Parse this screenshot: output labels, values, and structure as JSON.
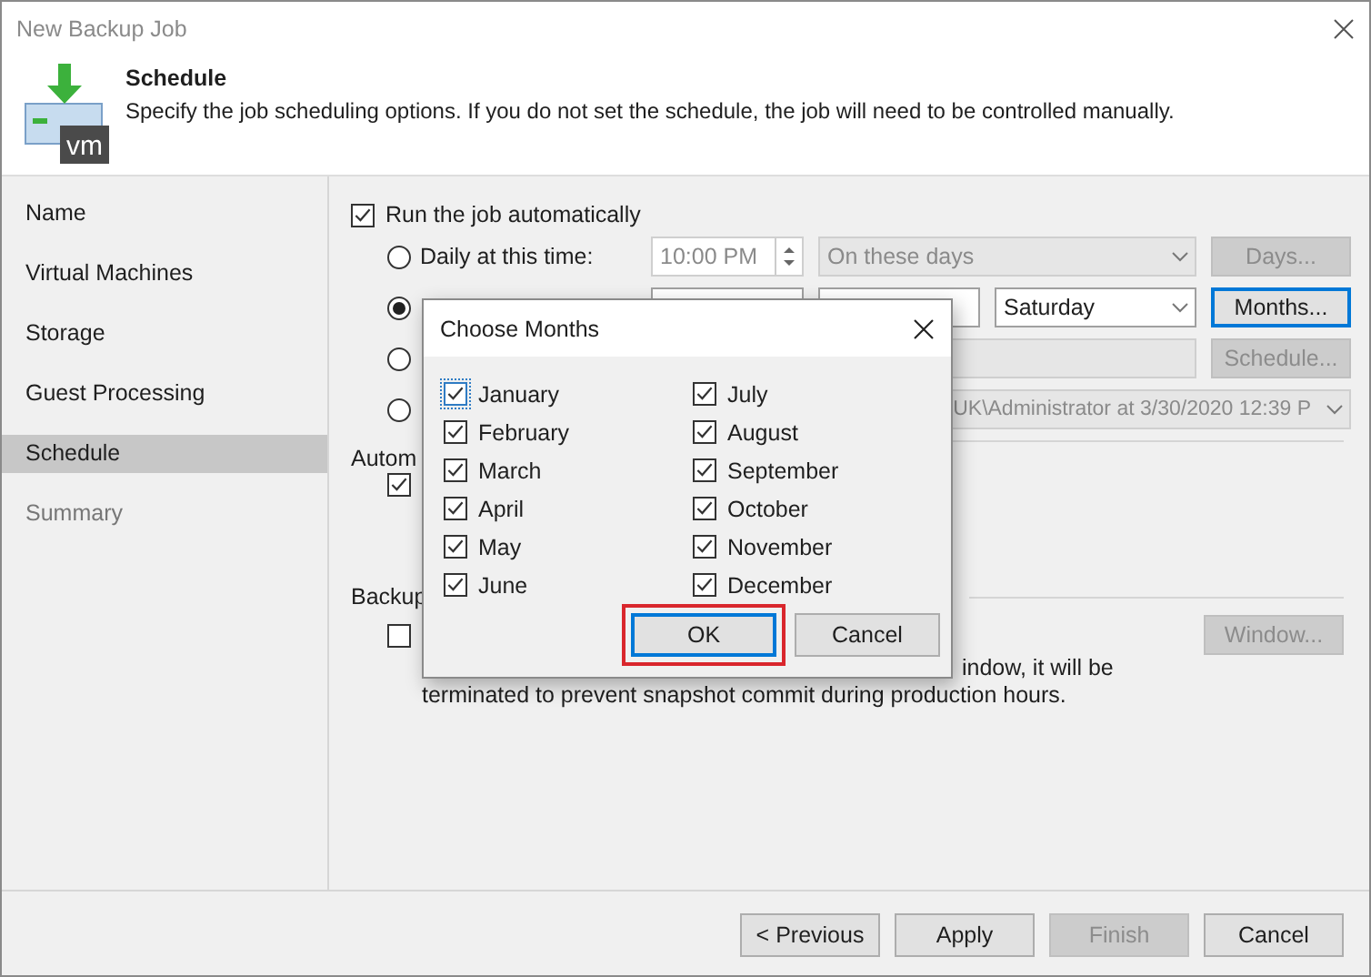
{
  "window": {
    "title": "New Backup Job"
  },
  "header": {
    "title": "Schedule",
    "description": "Specify the job scheduling options. If you do not set the schedule, the job will need to be controlled manually.",
    "icon_text": "vm"
  },
  "sidebar": {
    "items": [
      {
        "label": "Name",
        "selected": false,
        "disabled": false
      },
      {
        "label": "Virtual Machines",
        "selected": false,
        "disabled": false
      },
      {
        "label": "Storage",
        "selected": false,
        "disabled": false
      },
      {
        "label": "Guest Processing",
        "selected": false,
        "disabled": false
      },
      {
        "label": "Schedule",
        "selected": true,
        "disabled": false
      },
      {
        "label": "Summary",
        "selected": false,
        "disabled": true
      }
    ]
  },
  "schedule": {
    "run_automatically": {
      "label": "Run the job automatically",
      "checked": true
    },
    "options": [
      {
        "kind": "daily",
        "label": "Daily at this time:",
        "selected": false,
        "enabled": false,
        "time": "10:00 PM",
        "dropdown": "On these days",
        "button": "Days..."
      },
      {
        "kind": "monthly",
        "selected": true,
        "enabled": true,
        "dropdown": "Saturday",
        "button": "Months...",
        "focused": true
      },
      {
        "kind": "periodic",
        "selected": false,
        "enabled": false,
        "button": "Schedule..."
      },
      {
        "kind": "after_job",
        "selected": false,
        "enabled": false,
        "dropdown": "UK\\Administrator at 3/30/2020 12:39 P"
      }
    ]
  },
  "automatic_retry": {
    "label": "Autom",
    "checked": true
  },
  "backup_window": {
    "label": "Backup",
    "checked": false,
    "button": "Window...",
    "button_disabled": true,
    "note_lines": [
      "indow, it will be",
      "terminated to prevent snapshot commit during production hours."
    ]
  },
  "dialog": {
    "title": "Choose Months",
    "months": [
      {
        "label": "January",
        "checked": true,
        "focused": true
      },
      {
        "label": "February",
        "checked": true,
        "focused": false
      },
      {
        "label": "March",
        "checked": true,
        "focused": false
      },
      {
        "label": "April",
        "checked": true,
        "focused": false
      },
      {
        "label": "May",
        "checked": true,
        "focused": false
      },
      {
        "label": "June",
        "checked": true,
        "focused": false
      },
      {
        "label": "July",
        "checked": true,
        "focused": false
      },
      {
        "label": "August",
        "checked": true,
        "focused": false
      },
      {
        "label": "September",
        "checked": true,
        "focused": false
      },
      {
        "label": "October",
        "checked": true,
        "focused": false
      },
      {
        "label": "November",
        "checked": true,
        "focused": false
      },
      {
        "label": "December",
        "checked": true,
        "focused": false
      }
    ],
    "buttons": [
      {
        "label": "OK",
        "focused": true,
        "highlighted": true
      },
      {
        "label": "Cancel",
        "focused": false,
        "highlighted": false
      }
    ]
  },
  "footer": {
    "buttons": [
      {
        "label": "< Previous",
        "disabled": false
      },
      {
        "label": "Apply",
        "disabled": false
      },
      {
        "label": "Finish",
        "disabled": true
      },
      {
        "label": "Cancel",
        "disabled": false
      }
    ]
  }
}
